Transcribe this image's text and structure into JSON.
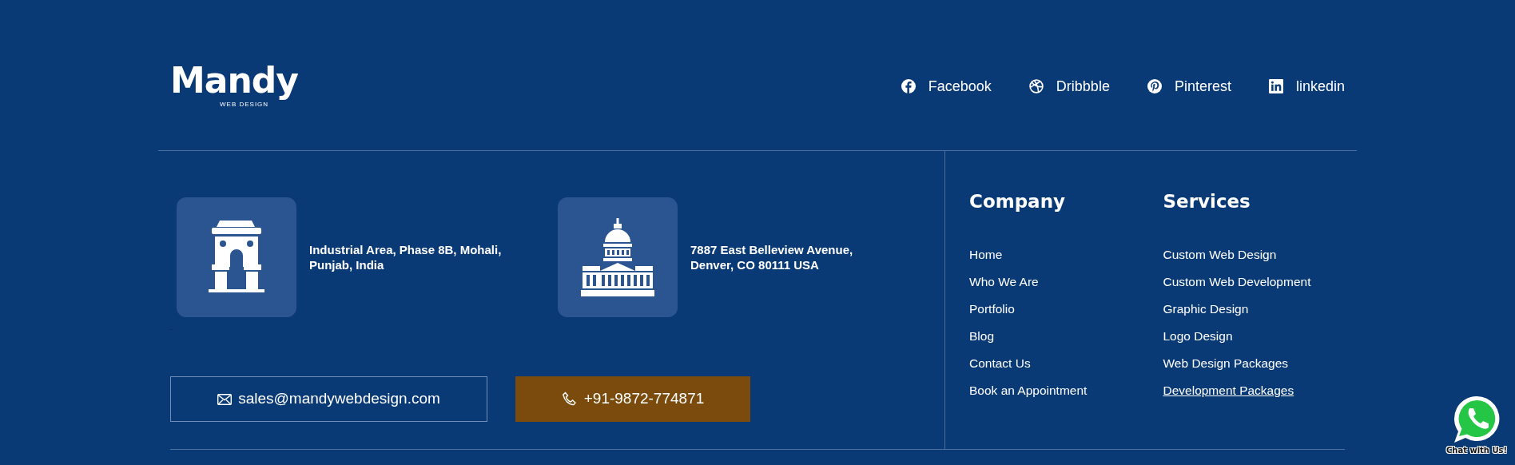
{
  "logo": {
    "name": "Mandy",
    "tagline": "WEB DESIGN"
  },
  "social_links": [
    {
      "kind": "facebook",
      "label": "Facebook"
    },
    {
      "kind": "dribbble",
      "label": "Dribbble"
    },
    {
      "kind": "pinterest",
      "label": "Pinterest"
    },
    {
      "kind": "linkedin",
      "label": "linkedin"
    }
  ],
  "addresses": [
    {
      "kind": "gate",
      "text": "Industrial Area, Phase 8B, Mohali, Punjab, India"
    },
    {
      "kind": "capitol",
      "text": "7887 East Belleview Avenue, Denver, CO 80111 USA"
    }
  ],
  "stray_mark": ".",
  "contact_buttons": [
    {
      "kind": "email",
      "label": "sales@mandywebdesign.com"
    },
    {
      "kind": "phone",
      "label": "+91-9872-774871"
    }
  ],
  "menus": [
    {
      "title": "Company",
      "items": [
        {
          "label": "Home",
          "underlined": false
        },
        {
          "label": "Who We Are",
          "underlined": false
        },
        {
          "label": "Portfolio",
          "underlined": false
        },
        {
          "label": "Blog",
          "underlined": false
        },
        {
          "label": "Contact Us",
          "underlined": false
        },
        {
          "label": "Book an Appointment",
          "underlined": false
        }
      ]
    },
    {
      "title": "Services",
      "items": [
        {
          "label": "Custom Web Design",
          "underlined": false
        },
        {
          "label": "Custom Web Development",
          "underlined": false
        },
        {
          "label": "Graphic Design",
          "underlined": false
        },
        {
          "label": "Logo Design",
          "underlined": false
        },
        {
          "label": "Web Design Packages",
          "underlined": false
        },
        {
          "label": "Development Packages",
          "underlined": true
        }
      ]
    }
  ],
  "chat_widget": {
    "label": "Chat with Us!"
  }
}
